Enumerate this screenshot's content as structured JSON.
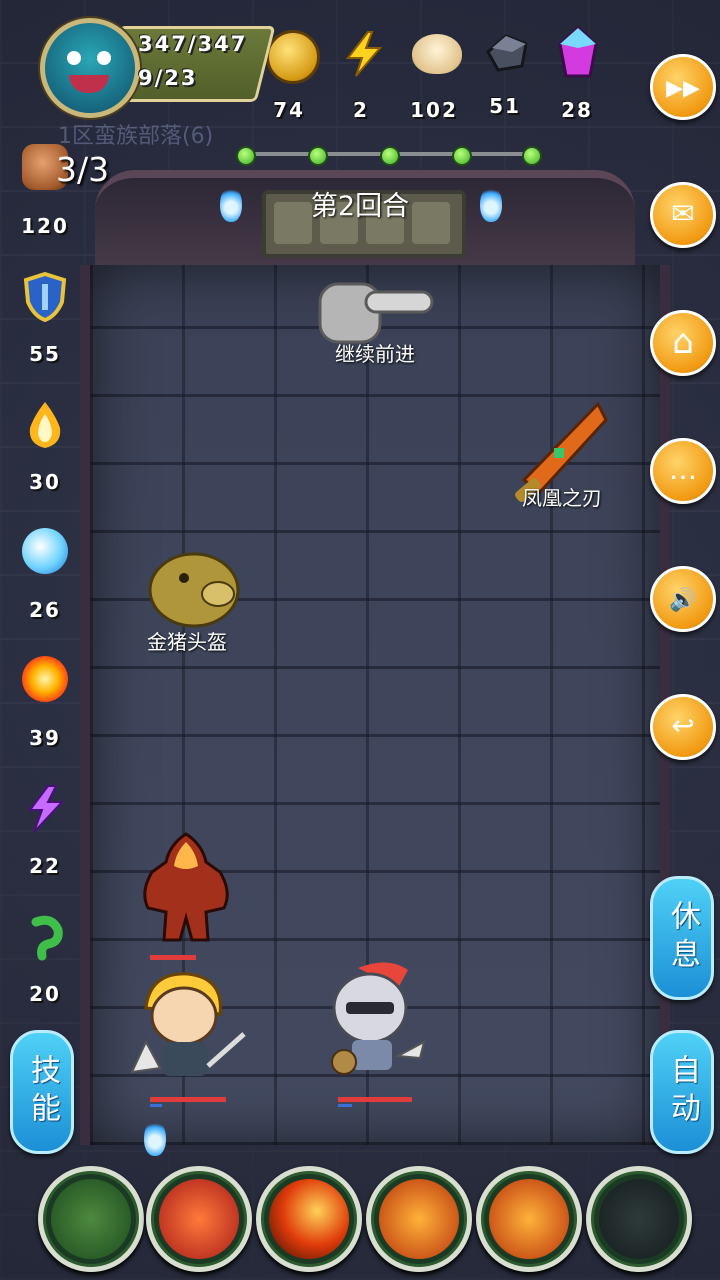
{
  "hud": {
    "hp": "347/347",
    "level_progress": "9/23",
    "zone_title": "1区蛮族部落(6)",
    "round_label": "第2回合"
  },
  "resources": [
    {
      "name": "gold",
      "icon": "gold-coin-icon",
      "value": "74"
    },
    {
      "name": "energy",
      "icon": "lightning-icon",
      "value": "2"
    },
    {
      "name": "bun",
      "icon": "bun-icon",
      "value": "102"
    },
    {
      "name": "ore",
      "icon": "iron-ore-icon",
      "value": "51"
    },
    {
      "name": "gem",
      "icon": "crystal-icon",
      "value": "28"
    }
  ],
  "stages": {
    "total": 5,
    "current": 2
  },
  "left_stats": {
    "fist_count": "3/3",
    "items": [
      {
        "icon": "fist-icon",
        "value": "120"
      },
      {
        "icon": "shield-icon",
        "value": "55"
      },
      {
        "icon": "holy-fire-icon",
        "value": "30"
      },
      {
        "icon": "water-wave-icon",
        "value": "26"
      },
      {
        "icon": "fireball-icon",
        "value": "39"
      },
      {
        "icon": "lightning-purple-icon",
        "value": "22"
      },
      {
        "icon": "poison-icon",
        "value": "20"
      }
    ]
  },
  "right_buttons": [
    {
      "name": "fast-forward",
      "icon": "▶▶"
    },
    {
      "name": "mail",
      "icon": "✉"
    },
    {
      "name": "home",
      "icon": "⌂"
    },
    {
      "name": "chat",
      "icon": "…"
    },
    {
      "name": "sound",
      "icon": "🔊"
    },
    {
      "name": "back",
      "icon": "↩"
    }
  ],
  "pills": {
    "skills": "技能",
    "rest": "休息",
    "auto": "自动"
  },
  "board": {
    "continue_label": "继续前进",
    "item1_label": "凤凰之刃",
    "item2_label": "金猪头盔"
  },
  "bars": {
    "fire_golem_hp": 1.0,
    "hero_hp": 1.0,
    "knight_hp": 1.0
  },
  "colors": {
    "accent_orange": "#f19a12",
    "pill_blue": "#1c8fd6",
    "progress_green": "#3fb02a"
  }
}
